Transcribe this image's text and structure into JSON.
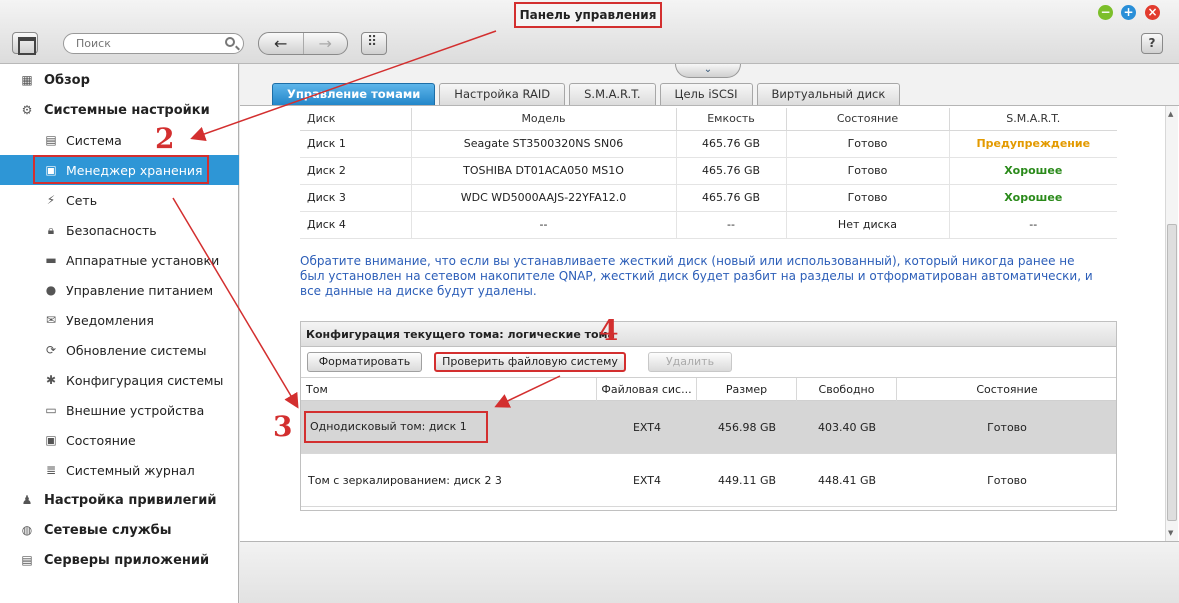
{
  "window": {
    "title": "Панель управления",
    "controls": {
      "minimize": "−",
      "maximize": "+",
      "close": "×"
    }
  },
  "toolbar": {
    "search_placeholder": "Поиск",
    "back": "←",
    "forward": "→",
    "help": "?"
  },
  "sidebar": {
    "items": [
      {
        "label": "Обзор",
        "icon": "overview-icon",
        "level": "top"
      },
      {
        "label": "Системные настройки",
        "icon": "gear-icon",
        "level": "top"
      },
      {
        "label": "Система",
        "icon": "system-icon",
        "level": "sub"
      },
      {
        "label": "Менеджер хранения",
        "icon": "storage-icon",
        "level": "sub",
        "active": true
      },
      {
        "label": "Сеть",
        "icon": "network-icon",
        "level": "sub"
      },
      {
        "label": "Безопасность",
        "icon": "lock-icon",
        "level": "sub"
      },
      {
        "label": "Аппаратные установки",
        "icon": "hardware-icon",
        "level": "sub"
      },
      {
        "label": "Управление питанием",
        "icon": "power-icon",
        "level": "sub"
      },
      {
        "label": "Уведомления",
        "icon": "notification-icon",
        "level": "sub"
      },
      {
        "label": "Обновление системы",
        "icon": "update-icon",
        "level": "sub"
      },
      {
        "label": "Конфигурация системы",
        "icon": "config-icon",
        "level": "sub"
      },
      {
        "label": "Внешние устройства",
        "icon": "external-device-icon",
        "level": "sub"
      },
      {
        "label": "Состояние",
        "icon": "monitor-icon",
        "level": "sub"
      },
      {
        "label": "Системный журнал",
        "icon": "log-icon",
        "level": "sub"
      },
      {
        "label": "Настройка привилегий",
        "icon": "user-icon",
        "level": "top"
      },
      {
        "label": "Сетевые службы",
        "icon": "globe-icon",
        "level": "top"
      },
      {
        "label": "Серверы приложений",
        "icon": "app-server-icon",
        "level": "top"
      }
    ]
  },
  "tabs": [
    "Управление томами",
    "Настройка RAID",
    "S.M.A.R.T.",
    "Цель iSCSI",
    "Виртуальный диск"
  ],
  "disks": {
    "headers": [
      "Диск",
      "Модель",
      "Емкость",
      "Состояние",
      "S.M.A.R.T."
    ],
    "rows": [
      [
        "Диск 1",
        "Seagate ST3500320NS SN06",
        "465.76 GB",
        "Готово",
        "Предупреждение"
      ],
      [
        "Диск 2",
        "TOSHIBA DT01ACA050 MS1O",
        "465.76 GB",
        "Готово",
        "Хорошее"
      ],
      [
        "Диск 3",
        "WDC WD5000AAJS-22YFA12.0",
        "465.76 GB",
        "Готово",
        "Хорошее"
      ],
      [
        "Диск 4",
        "--",
        "--",
        "Нет диска",
        "--"
      ]
    ]
  },
  "notice": "Обратите внимание, что если вы устанавливаете жесткий диск (новый или использованный), который никогда ранее не был установлен на сетевом накопителе QNAP, жесткий диск будет разбит на разделы и отформатирован автоматически, и все данные на диске будут удалены.",
  "volume": {
    "title": "Конфигурация текущего тома: логические тома",
    "buttons": {
      "format": "Форматировать",
      "check": "Проверить файловую систему",
      "delete": "Удалить"
    },
    "headers": [
      "Том",
      "Файловая сис...",
      "Размер",
      "Свободно",
      "Состояние"
    ],
    "rows": [
      [
        "Однодисковый том: диск 1",
        "EXT4",
        "456.98 GB",
        "403.40 GB",
        "Готово"
      ],
      [
        "Том с зеркалированием: диск 2 3",
        "EXT4",
        "449.11 GB",
        "448.41 GB",
        "Готово"
      ]
    ]
  },
  "annotations": [
    "2",
    "3",
    "4"
  ],
  "colors": {
    "accent": "#2e96d6",
    "annotation": "#d32f2f",
    "warning": "#e39a00",
    "good": "#2a8a1a",
    "notice": "#2c5eb8"
  }
}
